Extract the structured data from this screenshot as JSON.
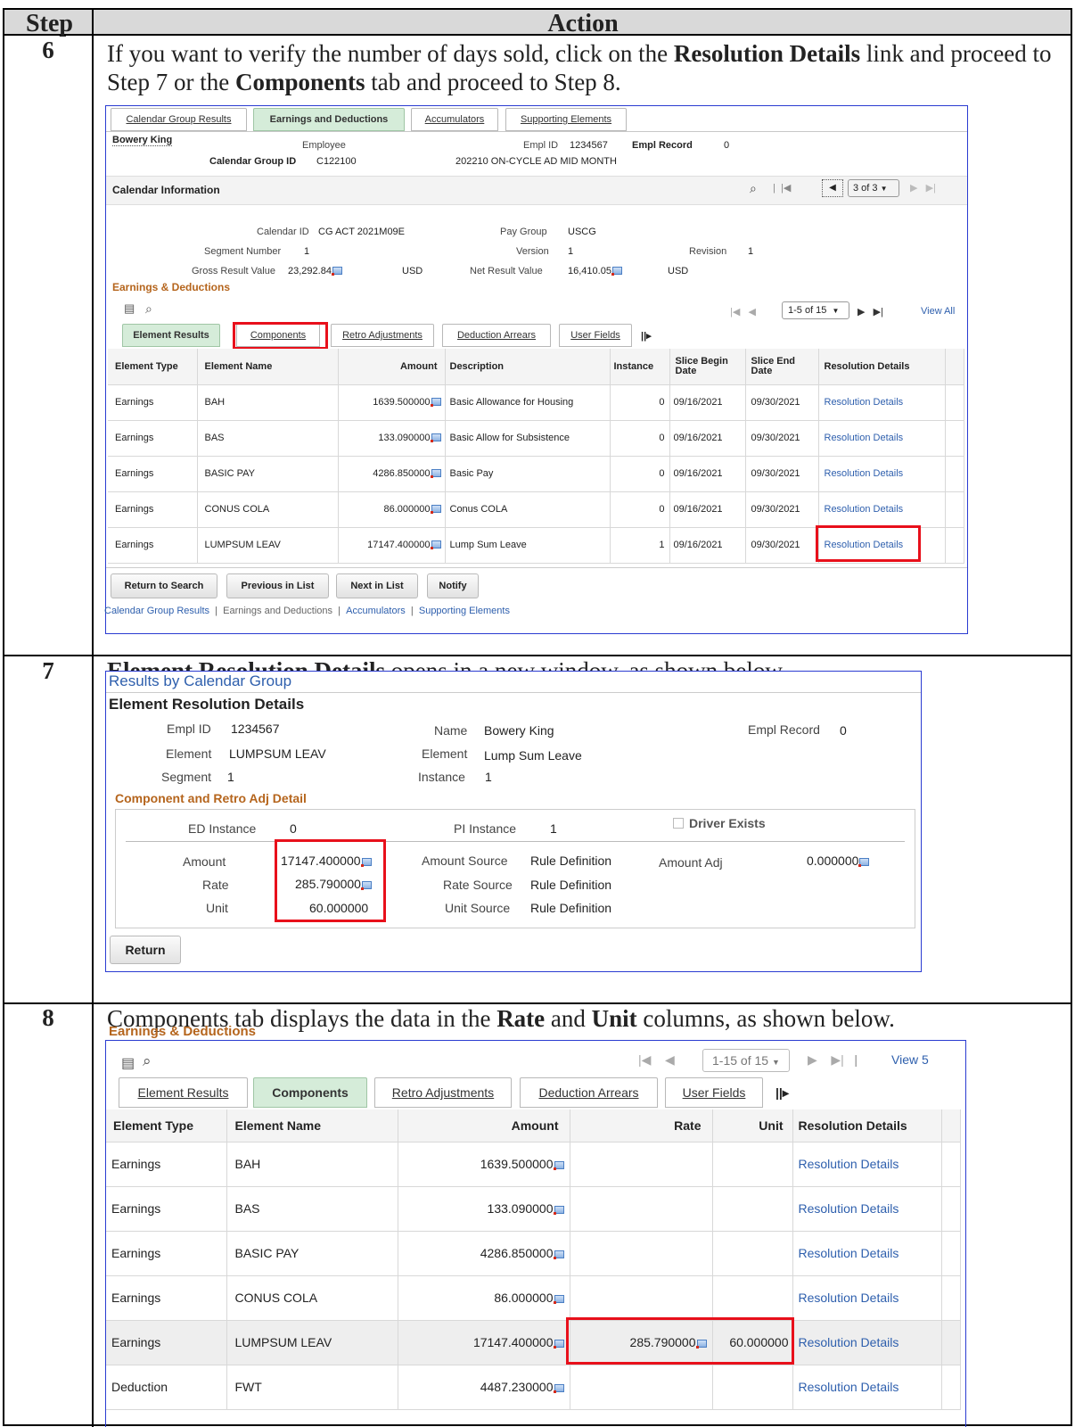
{
  "doc": {
    "head_step": "Step",
    "head_action": "Action",
    "s6": {
      "num": "6",
      "p1": "If you want to verify the number of days sold, click on the ",
      "b1": "Resolution Details",
      "p2": " link and proceed to Step 7 or the ",
      "b2": "Components",
      "p3": " tab and proceed to Step 8."
    },
    "s7": {
      "num": "7",
      "b1": "Element Resolution Details",
      "p1": " opens in a new window, as shown below."
    },
    "s8": {
      "num": "8",
      "p1": "Components tab displays the data in the ",
      "b1": "Rate",
      "p2": " and ",
      "b2": "Unit",
      "p3": " columns, as shown below."
    }
  },
  "shot1": {
    "tabs": [
      "Calendar Group Results",
      "Earnings and Deductions",
      "Accumulators",
      "Supporting Elements"
    ],
    "name": "Bowery King",
    "employee_lbl": "Employee",
    "emplid_lbl": "Empl ID",
    "emplid": "1234567",
    "emplrec_lbl": "Empl Record",
    "emplrec": "0",
    "calgrp_lbl": "Calendar Group ID",
    "calgrp": "C122100",
    "calgrp_desc": "202210 ON-CYCLE AD MID MONTH",
    "cal_info": "Calendar Information",
    "nav_count": "3 of 3",
    "calid_lbl": "Calendar ID",
    "calid": "CG ACT 2021M09E",
    "paygrp_lbl": "Pay Group",
    "paygrp": "USCG",
    "seg_lbl": "Segment Number",
    "seg": "1",
    "ver_lbl": "Version",
    "ver": "1",
    "rev_lbl": "Revision",
    "rev": "1",
    "gross_lbl": "Gross Result Value",
    "gross": "23,292.84",
    "usd": "USD",
    "net_lbl": "Net Result Value",
    "net": "16,410.05",
    "ed_title": "Earnings & Deductions",
    "page_count": "1-5 of 15",
    "view_all": "View All",
    "subtabs": [
      "Element Results",
      "Components",
      "Retro Adjustments",
      "Deduction Arrears",
      "User Fields"
    ],
    "cols": [
      "Element Type",
      "Element Name",
      "Amount",
      "Description",
      "Instance",
      "Slice Begin Date",
      "Slice End Date",
      "Resolution Details"
    ],
    "rows": [
      [
        "Earnings",
        "BAH",
        "1639.500000",
        "Basic Allowance for Housing",
        "0",
        "09/16/2021",
        "09/30/2021",
        "Resolution Details"
      ],
      [
        "Earnings",
        "BAS",
        "133.090000",
        "Basic Allow for Subsistence",
        "0",
        "09/16/2021",
        "09/30/2021",
        "Resolution Details"
      ],
      [
        "Earnings",
        "BASIC PAY",
        "4286.850000",
        "Basic Pay",
        "0",
        "09/16/2021",
        "09/30/2021",
        "Resolution Details"
      ],
      [
        "Earnings",
        "CONUS COLA",
        "86.000000",
        "Conus COLA",
        "0",
        "09/16/2021",
        "09/30/2021",
        "Resolution Details"
      ],
      [
        "Earnings",
        "LUMPSUM LEAV",
        "17147.400000",
        "Lump Sum Leave",
        "1",
        "09/16/2021",
        "09/30/2021",
        "Resolution Details"
      ]
    ],
    "buttons": [
      "Return to Search",
      "Previous in List",
      "Next in List",
      "Notify"
    ],
    "footer_links": [
      "Calendar Group Results",
      "Earnings and Deductions",
      "Accumulators",
      "Supporting Elements"
    ]
  },
  "shot2": {
    "crumb": "Results by Calendar Group",
    "title": "Element Resolution Details",
    "emplid_lbl": "Empl ID",
    "emplid": "1234567",
    "name_lbl": "Name",
    "name": "Bowery King",
    "emplrec_lbl": "Empl Record",
    "emplrec": "0",
    "elem_lbl": "Element",
    "elem": "LUMPSUM LEAV",
    "elem2_lbl": "Element",
    "elem2": "Lump Sum Leave",
    "seg_lbl": "Segment",
    "seg": "1",
    "inst_lbl": "Instance",
    "inst": "1",
    "section": "Component and Retro Adj Detail",
    "ed_inst_lbl": "ED Instance",
    "ed_inst": "0",
    "pi_inst_lbl": "PI Instance",
    "pi_inst": "1",
    "driver": "Driver Exists",
    "amount_lbl": "Amount",
    "amount": "17147.400000",
    "rate_lbl": "Rate",
    "rate": "285.790000",
    "unit_lbl": "Unit",
    "unit": "60.000000",
    "amt_src_lbl": "Amount Source",
    "amt_src": "Rule Definition",
    "rate_src_lbl": "Rate Source",
    "rate_src": "Rule Definition",
    "unit_src_lbl": "Unit Source",
    "unit_src": "Rule Definition",
    "amt_adj_lbl": "Amount Adj",
    "amt_adj": "0.000000",
    "return": "Return"
  },
  "shot3": {
    "title": "Earnings & Deductions",
    "page_count": "1-15 of 15",
    "view": "View 5",
    "subtabs": [
      "Element Results",
      "Components",
      "Retro Adjustments",
      "Deduction Arrears",
      "User Fields"
    ],
    "cols": [
      "Element Type",
      "Element Name",
      "Amount",
      "Rate",
      "Unit",
      "Resolution Details"
    ],
    "rows": [
      [
        "Earnings",
        "BAH",
        "1639.500000",
        "",
        "",
        "Resolution Details"
      ],
      [
        "Earnings",
        "BAS",
        "133.090000",
        "",
        "",
        "Resolution Details"
      ],
      [
        "Earnings",
        "BASIC PAY",
        "4286.850000",
        "",
        "",
        "Resolution Details"
      ],
      [
        "Earnings",
        "CONUS COLA",
        "86.000000",
        "",
        "",
        "Resolution Details"
      ],
      [
        "Earnings",
        "LUMPSUM LEAV",
        "17147.400000",
        "285.790000",
        "60.000000",
        "Resolution Details"
      ],
      [
        "Deduction",
        "FWT",
        "4487.230000",
        "",
        "",
        "Resolution Details"
      ]
    ]
  }
}
